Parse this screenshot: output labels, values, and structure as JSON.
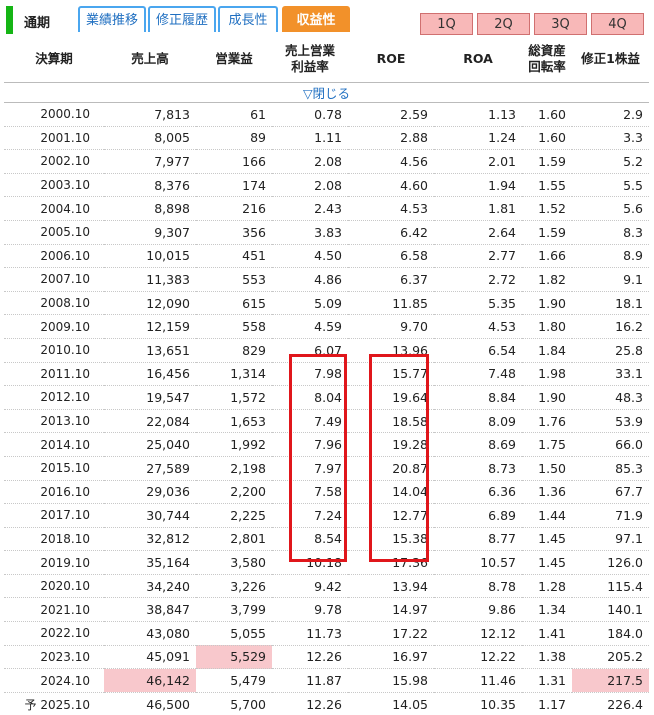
{
  "tabs": {
    "main_label": "通期",
    "items": [
      {
        "label": "業績推移"
      },
      {
        "label": "修正履歴"
      },
      {
        "label": "成長性"
      },
      {
        "label": "収益性"
      }
    ],
    "quarters": [
      "1Q",
      "2Q",
      "3Q",
      "4Q"
    ]
  },
  "table": {
    "headers": {
      "period": "決算期",
      "sales": "売上高",
      "op_income": "営業益",
      "op_margin_1": "売上営業",
      "op_margin_2": "利益率",
      "roe": "ROE",
      "roa": "ROA",
      "turnover_1": "総資産",
      "turnover_2": "回転率",
      "eps": "修正1株益"
    },
    "toggle_label": "▽閉じる",
    "rows": [
      {
        "period": "2000.10",
        "sales": "7,813",
        "op": "61",
        "margin": "0.78",
        "roe": "2.59",
        "roa": "1.13",
        "turnover": "1.60",
        "eps": "2.9"
      },
      {
        "period": "2001.10",
        "sales": "8,005",
        "op": "89",
        "margin": "1.11",
        "roe": "2.88",
        "roa": "1.24",
        "turnover": "1.60",
        "eps": "3.3"
      },
      {
        "period": "2002.10",
        "sales": "7,977",
        "op": "166",
        "margin": "2.08",
        "roe": "4.56",
        "roa": "2.01",
        "turnover": "1.59",
        "eps": "5.2"
      },
      {
        "period": "2003.10",
        "sales": "8,376",
        "op": "174",
        "margin": "2.08",
        "roe": "4.60",
        "roa": "1.94",
        "turnover": "1.55",
        "eps": "5.5"
      },
      {
        "period": "2004.10",
        "sales": "8,898",
        "op": "216",
        "margin": "2.43",
        "roe": "4.53",
        "roa": "1.81",
        "turnover": "1.52",
        "eps": "5.6"
      },
      {
        "period": "2005.10",
        "sales": "9,307",
        "op": "356",
        "margin": "3.83",
        "roe": "6.42",
        "roa": "2.64",
        "turnover": "1.59",
        "eps": "8.3"
      },
      {
        "period": "2006.10",
        "sales": "10,015",
        "op": "451",
        "margin": "4.50",
        "roe": "6.58",
        "roa": "2.77",
        "turnover": "1.66",
        "eps": "8.9"
      },
      {
        "period": "2007.10",
        "sales": "11,383",
        "op": "553",
        "margin": "4.86",
        "roe": "6.37",
        "roa": "2.72",
        "turnover": "1.82",
        "eps": "9.1"
      },
      {
        "period": "2008.10",
        "sales": "12,090",
        "op": "615",
        "margin": "5.09",
        "roe": "11.85",
        "roa": "5.35",
        "turnover": "1.90",
        "eps": "18.1"
      },
      {
        "period": "2009.10",
        "sales": "12,159",
        "op": "558",
        "margin": "4.59",
        "roe": "9.70",
        "roa": "4.53",
        "turnover": "1.80",
        "eps": "16.2"
      },
      {
        "period": "2010.10",
        "sales": "13,651",
        "op": "829",
        "margin": "6.07",
        "roe": "13.96",
        "roa": "6.54",
        "turnover": "1.84",
        "eps": "25.8"
      },
      {
        "period": "2011.10",
        "sales": "16,456",
        "op": "1,314",
        "margin": "7.98",
        "roe": "15.77",
        "roa": "7.48",
        "turnover": "1.98",
        "eps": "33.1"
      },
      {
        "period": "2012.10",
        "sales": "19,547",
        "op": "1,572",
        "margin": "8.04",
        "roe": "19.64",
        "roa": "8.84",
        "turnover": "1.90",
        "eps": "48.3"
      },
      {
        "period": "2013.10",
        "sales": "22,084",
        "op": "1,653",
        "margin": "7.49",
        "roe": "18.58",
        "roa": "8.09",
        "turnover": "1.76",
        "eps": "53.9"
      },
      {
        "period": "2014.10",
        "sales": "25,040",
        "op": "1,992",
        "margin": "7.96",
        "roe": "19.28",
        "roa": "8.69",
        "turnover": "1.75",
        "eps": "66.0"
      },
      {
        "period": "2015.10",
        "sales": "27,589",
        "op": "2,198",
        "margin": "7.97",
        "roe": "20.87",
        "roa": "8.73",
        "turnover": "1.50",
        "eps": "85.3"
      },
      {
        "period": "2016.10",
        "sales": "29,036",
        "op": "2,200",
        "margin": "7.58",
        "roe": "14.04",
        "roa": "6.36",
        "turnover": "1.36",
        "eps": "67.7"
      },
      {
        "period": "2017.10",
        "sales": "30,744",
        "op": "2,225",
        "margin": "7.24",
        "roe": "12.77",
        "roa": "6.89",
        "turnover": "1.44",
        "eps": "71.9"
      },
      {
        "period": "2018.10",
        "sales": "32,812",
        "op": "2,801",
        "margin": "8.54",
        "roe": "15.38",
        "roa": "8.77",
        "turnover": "1.45",
        "eps": "97.1"
      },
      {
        "period": "2019.10",
        "sales": "35,164",
        "op": "3,580",
        "margin": "10.18",
        "roe": "17.36",
        "roa": "10.57",
        "turnover": "1.45",
        "eps": "126.0"
      },
      {
        "period": "2020.10",
        "sales": "34,240",
        "op": "3,226",
        "margin": "9.42",
        "roe": "13.94",
        "roa": "8.78",
        "turnover": "1.28",
        "eps": "115.4"
      },
      {
        "period": "2021.10",
        "sales": "38,847",
        "op": "3,799",
        "margin": "9.78",
        "roe": "14.97",
        "roa": "9.86",
        "turnover": "1.34",
        "eps": "140.1"
      },
      {
        "period": "2022.10",
        "sales": "43,080",
        "op": "5,055",
        "margin": "11.73",
        "roe": "17.22",
        "roa": "12.12",
        "turnover": "1.41",
        "eps": "184.0"
      },
      {
        "period": "2023.10",
        "sales": "45,091",
        "op": "5,529",
        "margin": "12.26",
        "roe": "16.97",
        "roa": "12.22",
        "turnover": "1.38",
        "eps": "205.2"
      },
      {
        "period": "2024.10",
        "sales": "46,142",
        "op": "5,479",
        "margin": "11.87",
        "roe": "15.98",
        "roa": "11.46",
        "turnover": "1.31",
        "eps": "217.5"
      },
      {
        "period": "予 2025.10",
        "sales": "46,500",
        "op": "5,700",
        "margin": "12.26",
        "roe": "14.05",
        "roa": "10.35",
        "turnover": "1.17",
        "eps": "226.4"
      }
    ]
  },
  "colors": {
    "accent_green": "#15b515",
    "tab_border": "#4aa6ef",
    "tab_active": "#f2912a",
    "quarter_tab": "#f8b8b8",
    "highlight": "#f8c8cc",
    "annotation_box": "#e0161b"
  }
}
